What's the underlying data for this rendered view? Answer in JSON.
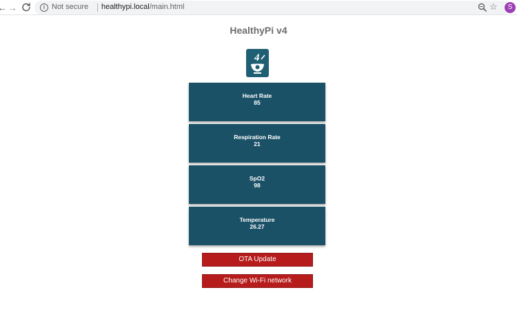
{
  "browser": {
    "back_icon": "←",
    "forward_icon": "→",
    "reload_icon": "C",
    "security_text": "Not secure",
    "url_host": "healthypi.local",
    "url_path": "/main.html",
    "star_icon": "☆",
    "avatar_letter": "S",
    "avatar_color": "#9c3fb5"
  },
  "page": {
    "title": "HealthyPi v4"
  },
  "cards": [
    {
      "label": "Heart Rate",
      "value": "85"
    },
    {
      "label": "Respiration Rate",
      "value": "21"
    },
    {
      "label": "SpO2",
      "value": "98"
    },
    {
      "label": "Temperature",
      "value": "26.27"
    }
  ],
  "buttons": {
    "ota": "OTA Update",
    "wifi": "Change Wi-Fi network"
  },
  "colors": {
    "card_bg": "#1b5167",
    "button_red": "#b71c1c"
  }
}
